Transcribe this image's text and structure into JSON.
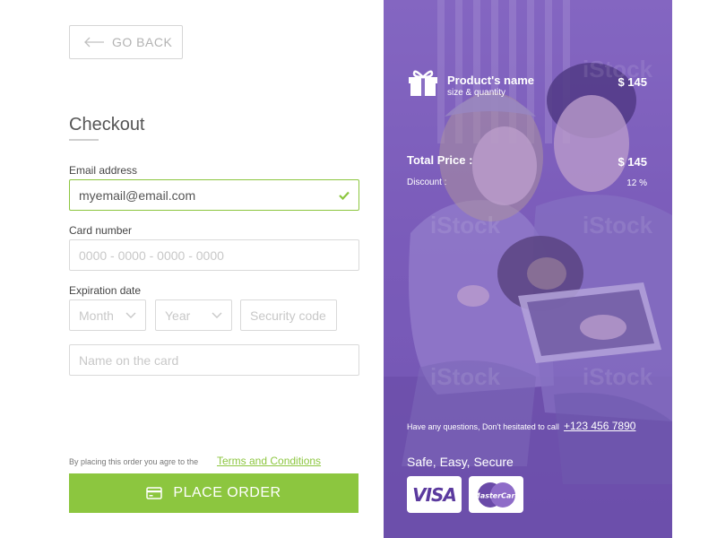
{
  "nav": {
    "back_label": "GO BACK"
  },
  "form": {
    "title": "Checkout",
    "email": {
      "label": "Email address",
      "value": "myemail@email.com"
    },
    "card": {
      "label": "Card number",
      "placeholder": "0000 - 0000 - 0000 - 0000"
    },
    "expiration": {
      "label": "Expiration date",
      "month": "Month",
      "year": "Year",
      "security_placeholder": "Security code"
    },
    "name_placeholder": "Name on the card",
    "terms_text": "By placing this order you agre to the",
    "terms_link": "Terms and Conditions",
    "submit_label": "PLACE ORDER"
  },
  "summary": {
    "product_name": "Product's name",
    "product_sub": "size & quantity",
    "product_price": "$ 145",
    "total_label": "Total Price :",
    "total_price": "$ 145",
    "discount_label": "Discount :",
    "discount_value": "12 %",
    "questions_text": "Have any questions, Don't hesitated to call",
    "phone": "+123 456 7890",
    "tagline": "Safe, Easy, Secure",
    "cards": {
      "visa": "VISA",
      "mastercard": "MasterCard"
    }
  },
  "colors": {
    "accent": "#8cc63f",
    "panel": "#7c5fb8"
  }
}
